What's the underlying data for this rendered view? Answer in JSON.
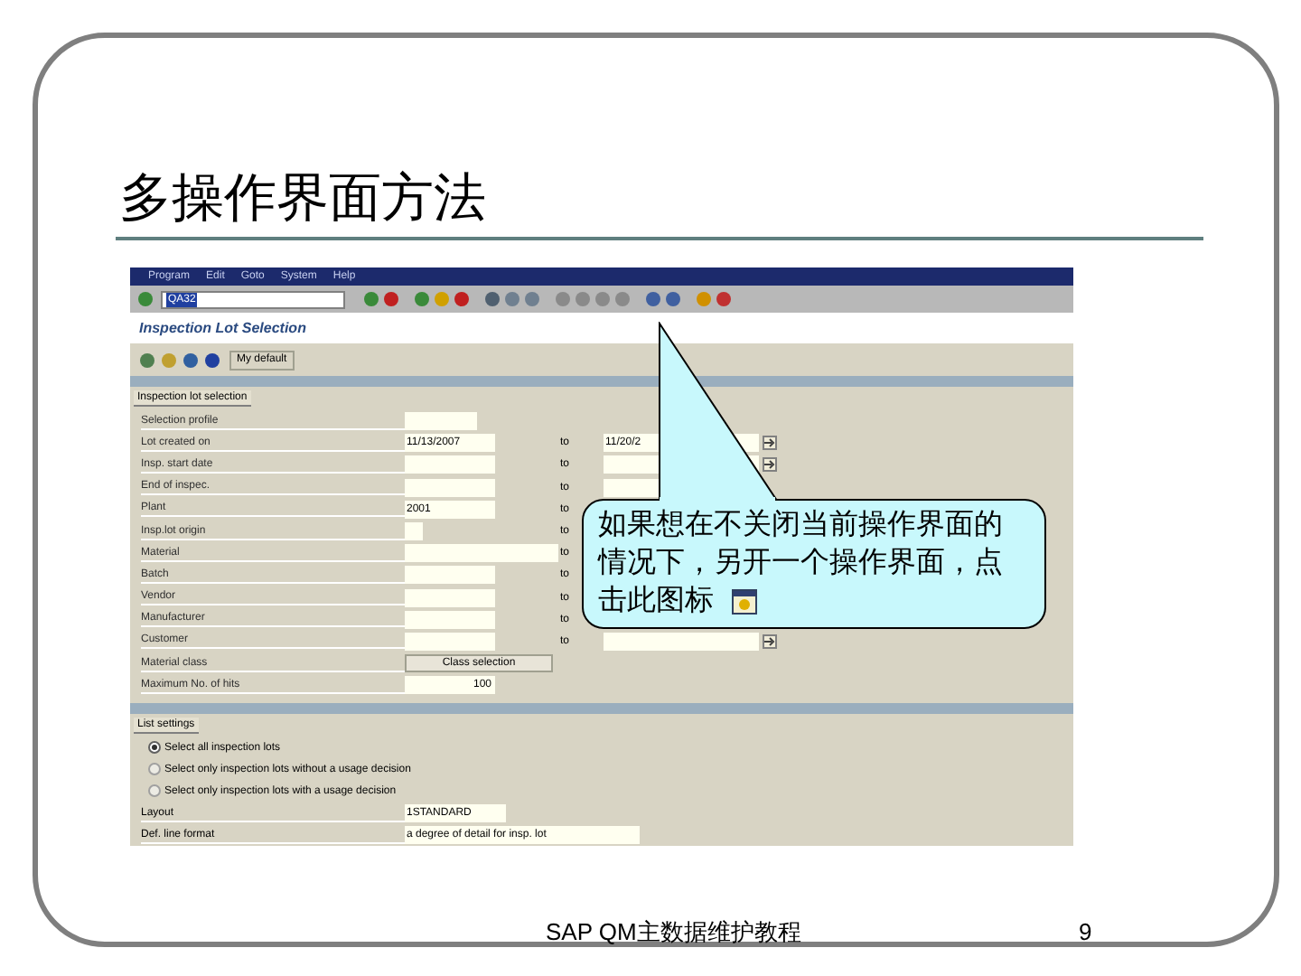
{
  "slide": {
    "title": "多操作界面方法",
    "footer": "SAP QM主数据维护教程",
    "page_number": "9"
  },
  "sap": {
    "menu": [
      "Program",
      "Edit",
      "Goto",
      "System",
      "Help"
    ],
    "command_field": {
      "value": "QA32"
    },
    "screen_title": "Inspection Lot Selection",
    "app_toolbar": {
      "button": "My default"
    },
    "selection_tab": "Inspection lot selection",
    "rows": [
      {
        "label": "Selection profile"
      },
      {
        "label": "Lot created on",
        "value": "11/13/2007",
        "to": "to",
        "to_value": "11/20/2",
        "more": true
      },
      {
        "label": "Insp. start date",
        "to": "to",
        "to_value": "",
        "more": true
      },
      {
        "label": "End of inspec.",
        "to": "to",
        "to_value": ""
      },
      {
        "label": "Plant",
        "value": "2001",
        "to": "to"
      },
      {
        "label": "Insp.lot origin",
        "to": "to"
      },
      {
        "label": "Material",
        "to": "to"
      },
      {
        "label": "Batch",
        "to": "to"
      },
      {
        "label": "Vendor",
        "to": "to"
      },
      {
        "label": "Manufacturer",
        "to": "to"
      },
      {
        "label": "Customer",
        "to": "to",
        "to_value": "",
        "more": true
      },
      {
        "label": "Material class",
        "button": "Class selection"
      },
      {
        "label": "Maximum No. of hits",
        "value": "100"
      }
    ],
    "list_tab": "List settings",
    "radios": [
      {
        "label": "Select all inspection lots",
        "selected": true
      },
      {
        "label": "Select only inspection lots without a usage decision",
        "selected": false
      },
      {
        "label": "Select only inspection lots with a usage decision",
        "selected": false
      }
    ],
    "settings": [
      {
        "label": "Layout",
        "value": "1STANDARD"
      },
      {
        "label": "Def. line format",
        "value": "a degree of detail for insp. lot"
      }
    ]
  },
  "callout": {
    "text": "如果想在不关闭当前操作界面的情况下，另开一个操作界面，点击此图标"
  }
}
